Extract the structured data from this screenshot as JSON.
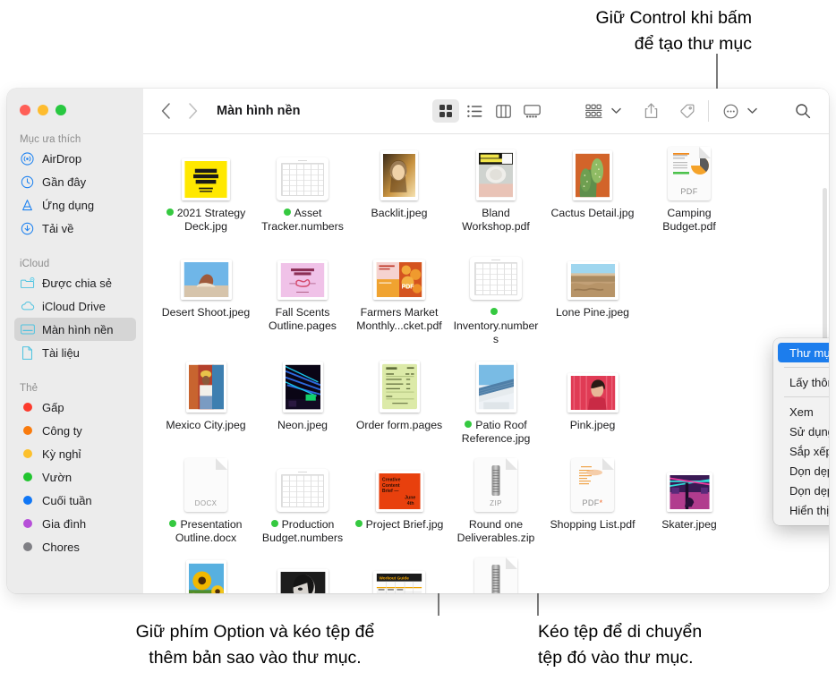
{
  "callouts": {
    "top": "Giữ Control khi bấm\nđể tạo thư mục",
    "bottom_left": "Giữ phím Option và kéo tệp để\nthêm bản sao vào thư mục.",
    "bottom_right": "Kéo tệp để di chuyển\ntệp đó vào thư mục."
  },
  "window": {
    "title": "Màn hình nền",
    "traffic_lights": [
      "close-red",
      "minimize-yellow",
      "zoom-green"
    ]
  },
  "toolbar": {
    "back": "back-arrow",
    "forward": "forward-arrow",
    "view_icon": "icon-view",
    "view_list": "list-view",
    "view_column": "column-view",
    "view_gallery": "gallery-view",
    "group_by": "group-by",
    "share": "share",
    "tags": "tags",
    "more": "more-actions",
    "search": "search"
  },
  "sidebar": {
    "sections": [
      {
        "title": "Mục ưa thích",
        "items": [
          {
            "label": "AirDrop",
            "icon": "airdrop-icon",
            "selected": false
          },
          {
            "label": "Gần đây",
            "icon": "clock-icon",
            "selected": false
          },
          {
            "label": "Ứng dụng",
            "icon": "apps-icon",
            "selected": false
          },
          {
            "label": "Tải về",
            "icon": "downloads-icon",
            "selected": false
          }
        ]
      },
      {
        "title": "iCloud",
        "items": [
          {
            "label": "Được chia sẻ",
            "icon": "shared-folder-icon",
            "selected": false
          },
          {
            "label": "iCloud Drive",
            "icon": "cloud-icon",
            "selected": false
          },
          {
            "label": "Màn hình nền",
            "icon": "desktop-icon",
            "selected": true
          },
          {
            "label": "Tài liệu",
            "icon": "document-icon",
            "selected": false
          }
        ]
      },
      {
        "title": "Thẻ",
        "items": [
          {
            "label": "Gấp",
            "icon": "tag-dot",
            "color": "#fc3b2d"
          },
          {
            "label": "Công ty",
            "icon": "tag-dot",
            "color": "#f97b0d"
          },
          {
            "label": "Kỳ nghỉ",
            "icon": "tag-dot",
            "color": "#fcc02c"
          },
          {
            "label": "Vườn",
            "icon": "tag-dot",
            "color": "#21c52f"
          },
          {
            "label": "Cuối tuần",
            "icon": "tag-dot",
            "color": "#1177f5"
          },
          {
            "label": "Gia đình",
            "icon": "tag-dot",
            "color": "#b64fd8"
          },
          {
            "label": "Chores",
            "icon": "tag-dot",
            "color": "#7f7f84"
          }
        ]
      }
    ]
  },
  "files": [
    {
      "name": "2021 Strategy Deck.jpg",
      "kind": "image",
      "tag": "#35c940"
    },
    {
      "name": "Asset Tracker.numbers",
      "kind": "sheet",
      "tag": "#35c940"
    },
    {
      "name": "Backlit.jpeg",
      "kind": "image",
      "tag": null
    },
    {
      "name": "Bland Workshop.pdf",
      "kind": "image",
      "tag": null
    },
    {
      "name": "Cactus Detail.jpg",
      "kind": "image",
      "tag": null
    },
    {
      "name": "Camping Budget.pdf",
      "kind": "pdfdoc",
      "tag": null
    },
    {
      "name": "Desert Shoot.jpeg",
      "kind": "image",
      "tag": null
    },
    {
      "name": "Fall Scents Outline.pages",
      "kind": "image",
      "tag": null
    },
    {
      "name": "Farmers Market Monthly...cket.pdf",
      "kind": "image",
      "tag": null
    },
    {
      "name": "Inventory.numbers",
      "kind": "sheet",
      "tag": "#35c940"
    },
    {
      "name": "Lone Pine.jpeg",
      "kind": "image",
      "tag": null
    },
    {
      "name": "Mexico City.jpeg",
      "kind": "image",
      "tag": null
    },
    {
      "name": "Neon.jpeg",
      "kind": "image",
      "tag": null
    },
    {
      "name": "Order form.pages",
      "kind": "image",
      "tag": null
    },
    {
      "name": "Patio Roof Reference.jpg",
      "kind": "image",
      "tag": "#35c940"
    },
    {
      "name": "Pink.jpeg",
      "kind": "image",
      "tag": null
    },
    {
      "name": "Presentation Outline.docx",
      "kind": "docx",
      "tag": "#35c940"
    },
    {
      "name": "Production Budget.numbers",
      "kind": "sheet",
      "tag": "#35c940"
    },
    {
      "name": "Project Brief.jpg",
      "kind": "image",
      "tag": "#35c940"
    },
    {
      "name": "Round one Deliverables.zip",
      "kind": "zip",
      "tag": null
    },
    {
      "name": "Shopping List.pdf",
      "kind": "pdfdoc",
      "tag": null
    },
    {
      "name": "Skater.jpeg",
      "kind": "image",
      "tag": null
    }
  ],
  "context_menu": {
    "items": [
      {
        "label": "Thư mục mới",
        "selected": true,
        "submenu": false
      },
      {
        "separator": true
      },
      {
        "label": "Lấy thông tin",
        "selected": false,
        "submenu": false
      },
      {
        "separator": true
      },
      {
        "label": "Xem",
        "selected": false,
        "submenu": true
      },
      {
        "label": "Sử dụng Nhóm",
        "selected": false,
        "submenu": false
      },
      {
        "label": "Sắp xếp theo",
        "selected": false,
        "submenu": true
      },
      {
        "label": "Dọn dẹp",
        "selected": false,
        "submenu": false
      },
      {
        "label": "Dọn dẹp theo",
        "selected": false,
        "submenu": true
      },
      {
        "label": "Hiển thị tùy chọn Xem",
        "selected": false,
        "submenu": false
      }
    ],
    "highlight_color": "#1c7ded"
  }
}
